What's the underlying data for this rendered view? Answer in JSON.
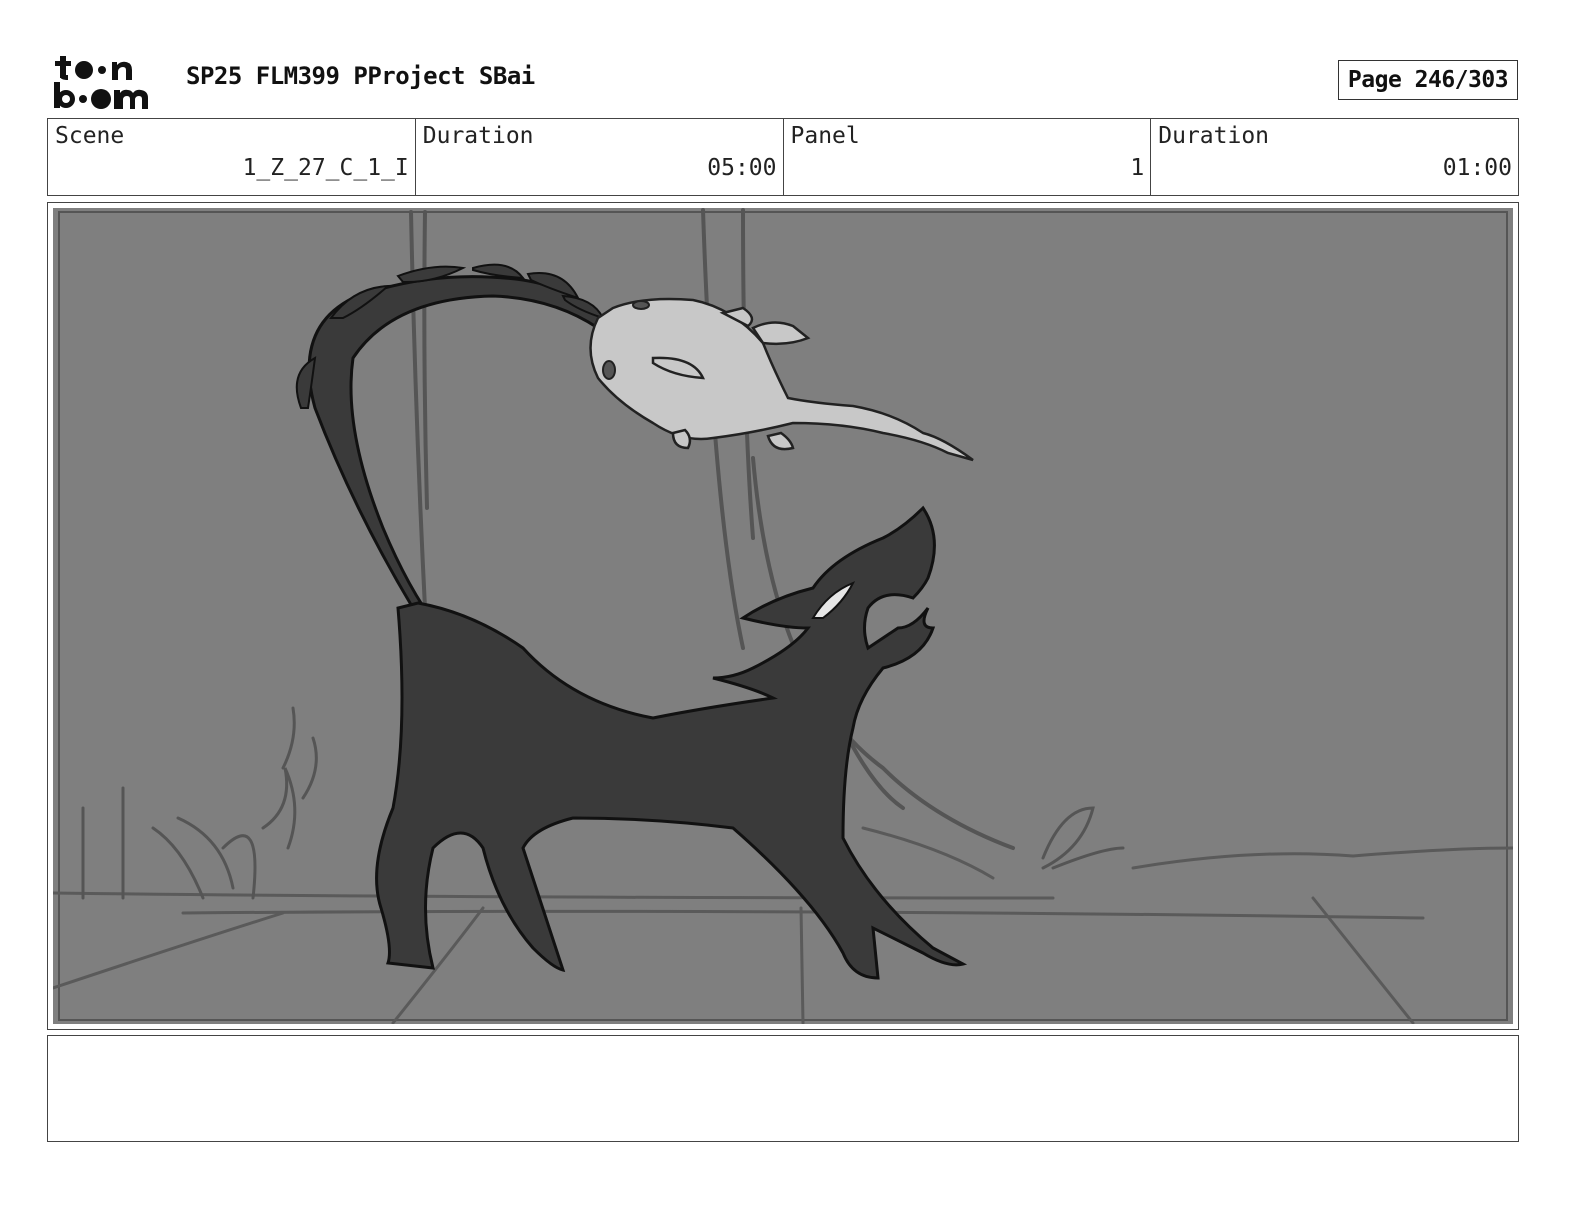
{
  "header": {
    "logo_top": "t••n",
    "logo_bottom": "b••m",
    "project_title": "SP25 FLM399 PProject SBai",
    "page_label": "Page 246/303"
  },
  "info": {
    "scene_label": "Scene",
    "scene_value": "1_Z_27_C_1_I",
    "scene_duration_label": "Duration",
    "scene_duration_value": "05:00",
    "panel_label": "Panel",
    "panel_value": "1",
    "panel_duration_label": "Duration",
    "panel_duration_value": "01:00"
  },
  "panel_image": {
    "background_color": "#7f7f7f",
    "creature_color": "#3a3a3a",
    "axolotl_color": "#c8c8c8"
  },
  "notes": {
    "text": ""
  }
}
